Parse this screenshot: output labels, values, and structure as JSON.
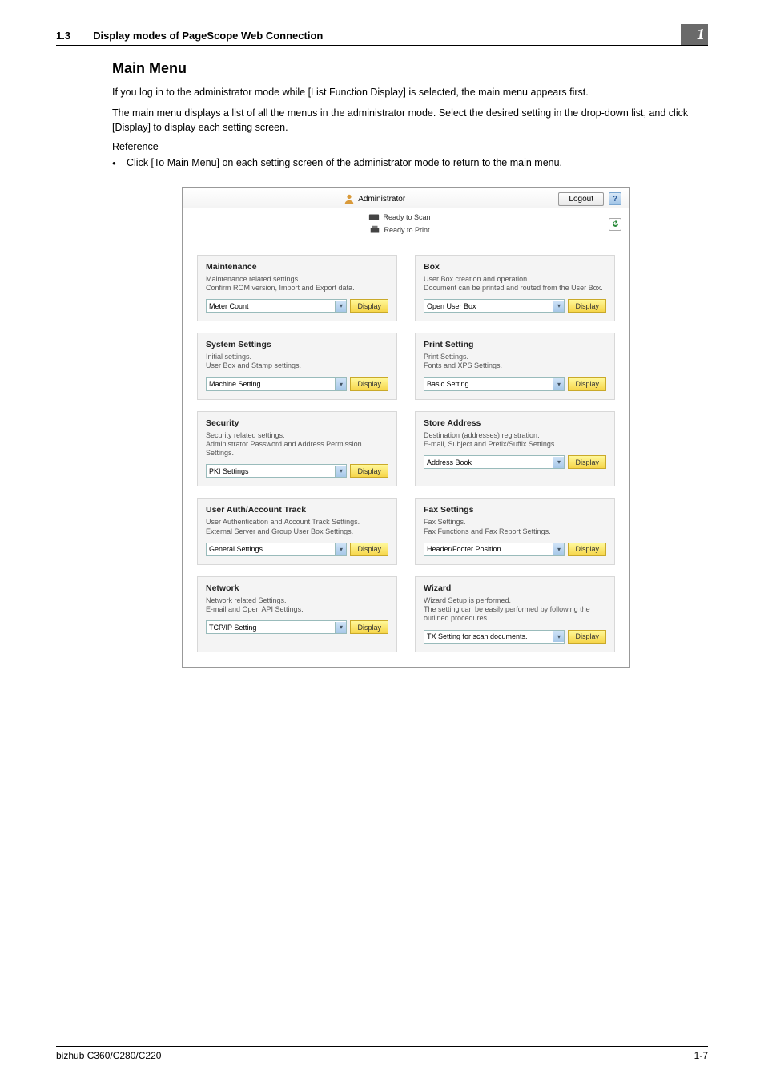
{
  "header": {
    "section_number": "1.3",
    "section_title": "Display modes of PageScope Web Connection",
    "chapter_number": "1"
  },
  "main": {
    "title": "Main Menu",
    "p1": "If you log in to the administrator mode while  [List Function Display] is selected, the main menu appears first.",
    "p2": "The main menu displays a list of all the menus in the administrator mode. Select the desired setting in the drop-down list, and click [Display] to display each setting screen.",
    "reference_label": "Reference",
    "bullet1": "Click [To Main Menu] on each setting screen of the administrator mode to return to the main menu."
  },
  "shot": {
    "admin_label": "Administrator",
    "logout_label": "Logout",
    "help_label": "?",
    "status_scan": "Ready to Scan",
    "status_print": "Ready to Print",
    "display_btn": "Display",
    "cards": [
      {
        "title": "Maintenance",
        "desc": "Maintenance related settings.\nConfirm ROM version, Import and Export data.",
        "select": "Meter Count"
      },
      {
        "title": "Box",
        "desc": "User Box creation and operation.\nDocument can be printed and routed from the User Box.",
        "select": "Open User Box"
      },
      {
        "title": "System Settings",
        "desc": "Initial settings.\nUser Box and Stamp settings.",
        "select": "Machine Setting"
      },
      {
        "title": "Print Setting",
        "desc": "Print Settings.\nFonts and XPS Settings.",
        "select": "Basic Setting"
      },
      {
        "title": "Security",
        "desc": "Security related settings.\nAdministrator Password and Address Permission Settings.",
        "select": "PKI Settings"
      },
      {
        "title": "Store Address",
        "desc": "Destination (addresses) registration.\nE-mail, Subject and Prefix/Suffix Settings.",
        "select": "Address Book"
      },
      {
        "title": "User Auth/Account Track",
        "desc": "User Authentication and Account Track Settings.\nExternal Server and Group User Box Settings.",
        "select": "General Settings"
      },
      {
        "title": "Fax Settings",
        "desc": "Fax Settings.\nFax Functions and Fax Report Settings.",
        "select": "Header/Footer Position"
      },
      {
        "title": "Network",
        "desc": "Network related Settings.\nE-mail and Open API Settings.",
        "select": "TCP/IP Setting"
      },
      {
        "title": "Wizard",
        "desc": "Wizard Setup is performed.\nThe setting can be easily performed by following the outlined procedures.",
        "select": "TX Setting for scan documents."
      }
    ]
  },
  "footer": {
    "model": "bizhub C360/C280/C220",
    "page": "1-7"
  }
}
